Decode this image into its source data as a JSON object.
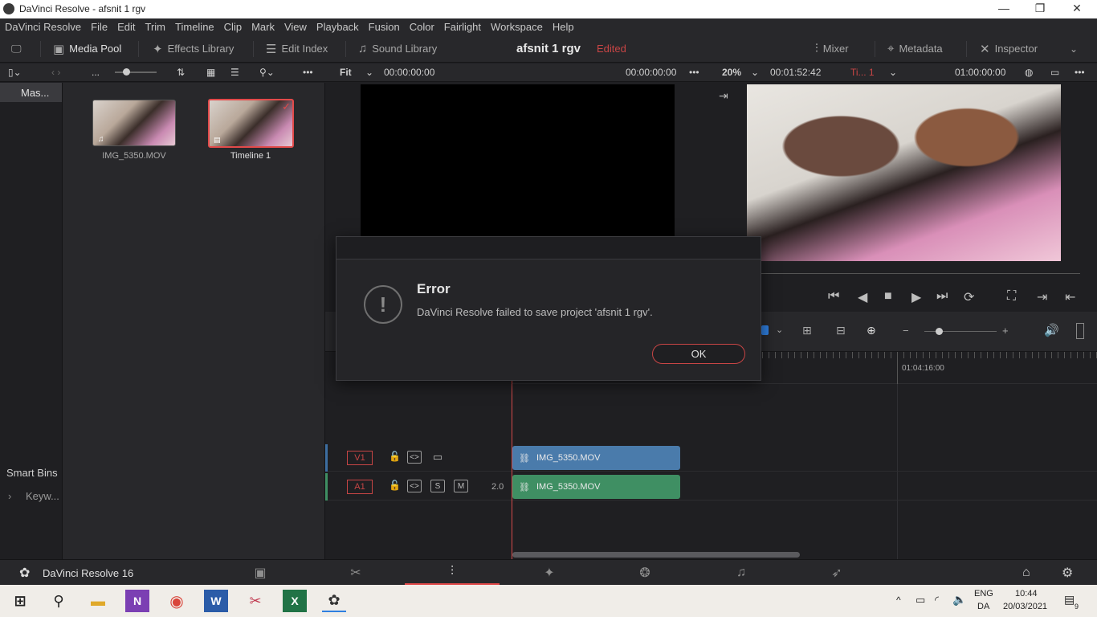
{
  "window": {
    "title": "DaVinci Resolve - afsnit 1 rgv",
    "min": "—",
    "max": "❐",
    "close": "✕"
  },
  "menu": [
    "DaVinci Resolve",
    "File",
    "Edit",
    "Trim",
    "Timeline",
    "Clip",
    "Mark",
    "View",
    "Playback",
    "Fusion",
    "Color",
    "Fairlight",
    "Workspace",
    "Help"
  ],
  "toolbar": {
    "media_pool": "Media Pool",
    "effects_library": "Effects Library",
    "edit_index": "Edit Index",
    "sound_library": "Sound Library",
    "project_name": "afsnit 1 rgv",
    "edited": "Edited",
    "mixer": "Mixer",
    "metadata": "Metadata",
    "inspector": "Inspector"
  },
  "subbar": {
    "dots": "...",
    "fit": "Fit",
    "src_tc_left": "00:00:00:00",
    "src_tc_right": "00:00:00:00",
    "zoom": "20%",
    "duration": "00:01:52:42",
    "timeline_name": "Ti... 1",
    "prog_tc": "01:00:00:00"
  },
  "bins": {
    "master": "Mas...",
    "smart_bins": "Smart Bins",
    "keywords": "Keyw..."
  },
  "media": [
    {
      "name": "IMG_5350.MOV"
    },
    {
      "name": "Timeline 1"
    }
  ],
  "timeline": {
    "ruler_tc": "01:04:16:00",
    "v1": "V1",
    "a1": "A1",
    "solo": "S",
    "mute": "M",
    "audio_level": "2.0",
    "video_clip": "IMG_5350.MOV",
    "audio_clip": "IMG_5350.MOV",
    "colors": {
      "video": "#4a7bab",
      "audio": "#3f8f63",
      "playhead": "#d54b4b"
    }
  },
  "pagebar": {
    "app_label": "DaVinci Resolve 16"
  },
  "dialog": {
    "title": "Error",
    "message": "DaVinci Resolve failed to save project 'afsnit 1 rgv'.",
    "ok": "OK"
  },
  "taskbar": {
    "lang": "ENG",
    "region": "DA",
    "time": "10:44",
    "date": "20/03/2021",
    "notif_count": "9"
  }
}
